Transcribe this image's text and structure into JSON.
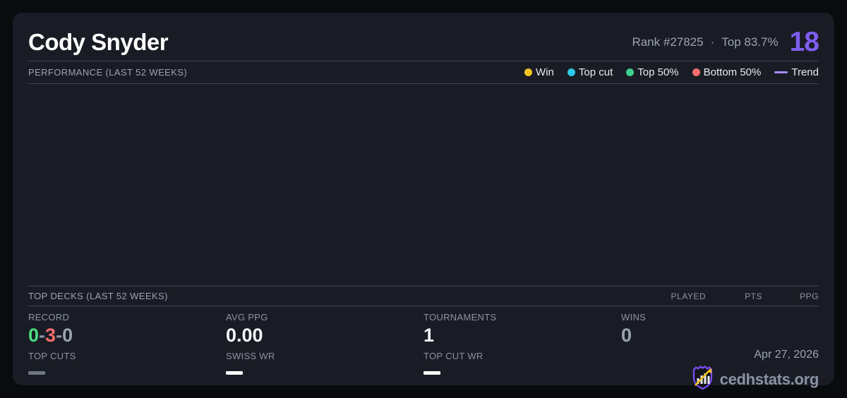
{
  "header": {
    "player_name": "Cody Snyder",
    "rank_text": "Rank #27825",
    "separator": "·",
    "top_percent_text": "Top 83.7%",
    "score": "18"
  },
  "performance": {
    "title": "PERFORMANCE (LAST 52 WEEKS)",
    "legend": {
      "win": "Win",
      "top_cut": "Top cut",
      "top_50": "Top 50%",
      "bottom_50": "Bottom 50%",
      "trend": "Trend"
    },
    "chart_note_visible_points": ""
  },
  "top_decks": {
    "title": "TOP DECKS (LAST 52 WEEKS)",
    "columns": {
      "played": "PLAYED",
      "pts": "PTS",
      "ppg": "PPG"
    },
    "rows": []
  },
  "stats": {
    "record": {
      "label": "RECORD",
      "wins": "0",
      "losses": "3",
      "draws": "0",
      "separator": "-"
    },
    "avg_ppg": {
      "label": "AVG PPG",
      "value": "0.00"
    },
    "tournaments": {
      "label": "TOURNAMENTS",
      "value": "1"
    },
    "wins": {
      "label": "WINS",
      "value": "0"
    },
    "top_cuts": {
      "label": "TOP CUTS",
      "value": "—"
    },
    "swiss_wr": {
      "label": "SWISS WR",
      "value": "—"
    },
    "top_cut_wr": {
      "label": "TOP CUT WR",
      "value": "—"
    }
  },
  "footer": {
    "date": "Apr 27, 2026",
    "site": "cedhstats.org"
  },
  "colors": {
    "page_bg": "#0a0b0f",
    "card_bg": "#1a1c25",
    "divider": "#3d4454",
    "accent_purple": "#7e5ef0",
    "legend_win": "#f5c21f",
    "legend_top_cut": "#2cc9e8",
    "legend_top_50": "#3fcf8e",
    "legend_bottom_50": "#f56d6d",
    "trend": "#a78bfa",
    "record_win_green": "#4ade80",
    "record_loss_red": "#f56d6d",
    "text_primary": "#ffffff",
    "text_secondary": "#9aa3b2"
  }
}
